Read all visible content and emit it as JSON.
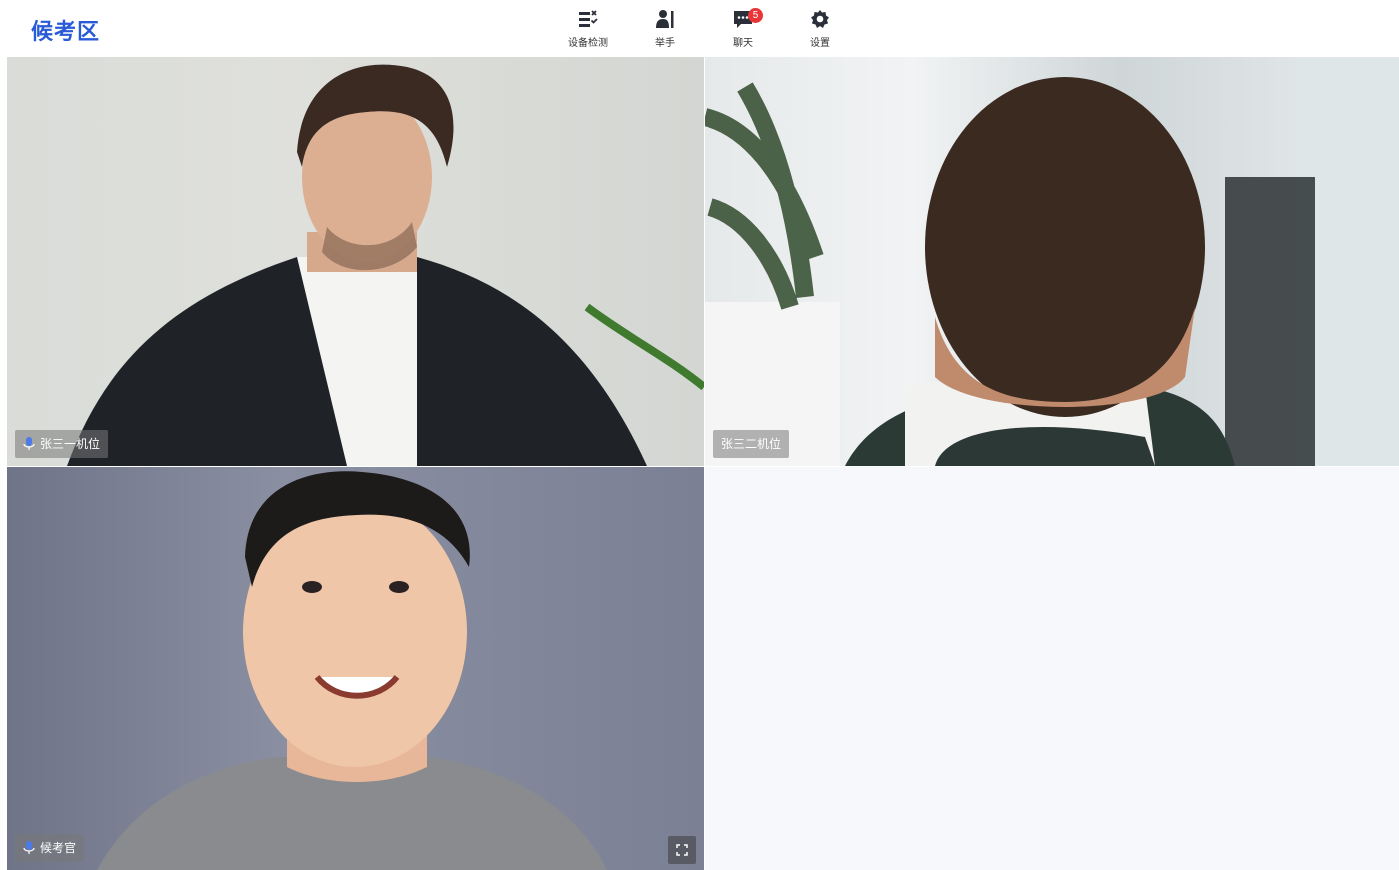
{
  "header": {
    "title": "候考区",
    "brand_color": "#2a5bd7",
    "tools": [
      {
        "label": "设备检测",
        "icon": "device-check-icon"
      },
      {
        "label": "举手",
        "icon": "raise-hand-icon"
      },
      {
        "label": "聊天",
        "icon": "chat-icon",
        "badge": "5"
      },
      {
        "label": "设置",
        "icon": "gear-icon"
      }
    ]
  },
  "videos": [
    {
      "name": "张三一机位",
      "mic": true
    },
    {
      "name": "张三二机位",
      "mic": false
    },
    {
      "name": "候考官",
      "mic": true,
      "fullscreen": true
    }
  ]
}
